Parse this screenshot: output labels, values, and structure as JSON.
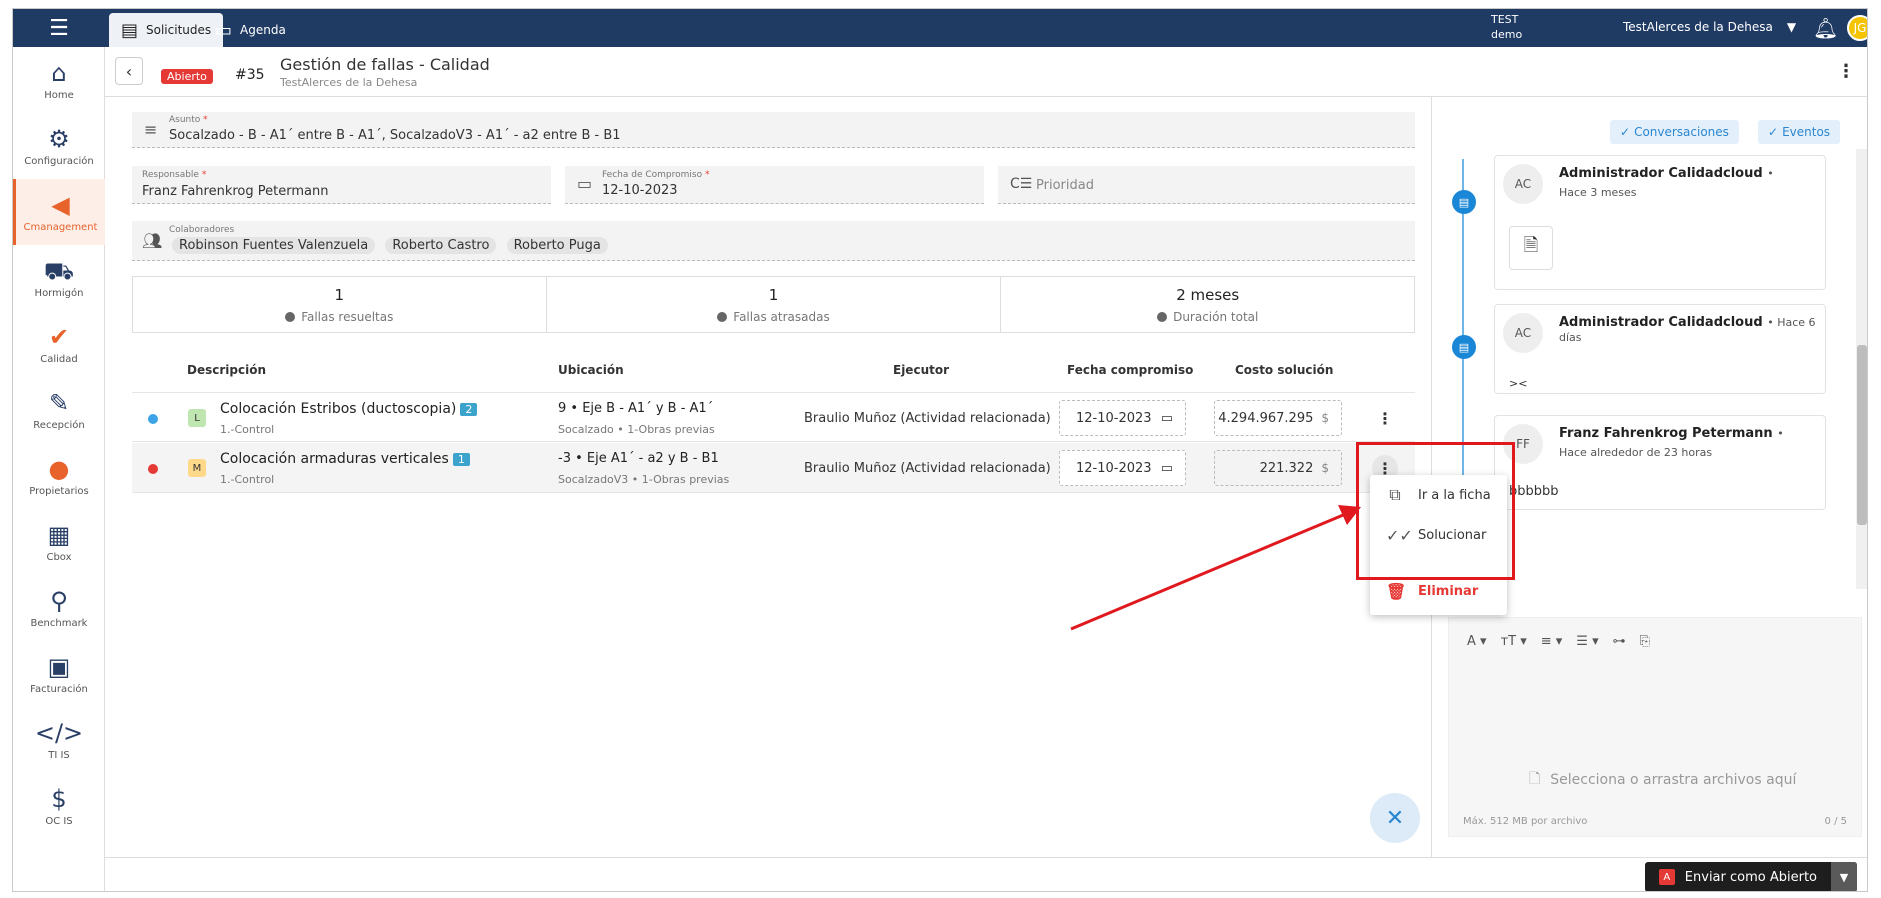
{
  "topbar": {
    "tabs": [
      {
        "label": "Solicitudes",
        "icon": "list-icon"
      },
      {
        "label": "Agenda",
        "icon": "calendar-icon"
      }
    ],
    "env_line1": "TEST",
    "env_line2": "demo",
    "company": "TestAlerces de la Dehesa",
    "avatar_initials": "JG"
  },
  "sidebar": {
    "items": [
      {
        "label": "Home",
        "icon": "home-icon"
      },
      {
        "label": "Configuración",
        "icon": "gear-icon"
      },
      {
        "label": "Cmanagement",
        "icon": "cmanagement-icon",
        "active": true
      },
      {
        "label": "Hormigón",
        "icon": "wheelbarrow-icon"
      },
      {
        "label": "Calidad",
        "icon": "quality-icon"
      },
      {
        "label": "Recepción",
        "icon": "reception-icon"
      },
      {
        "label": "Propietarios",
        "icon": "owner-icon"
      },
      {
        "label": "Cbox",
        "icon": "cbox-icon"
      },
      {
        "label": "Benchmark",
        "icon": "benchmark-icon"
      },
      {
        "label": "Facturación",
        "icon": "invoice-icon"
      },
      {
        "label": "TI IS",
        "icon": "code-icon"
      },
      {
        "label": "OC IS",
        "icon": "dollar-icon"
      }
    ]
  },
  "header": {
    "status": "Abierto",
    "number": "#35",
    "title": "Gestión de fallas - Calidad",
    "subtitle": "TestAlerces de la Dehesa"
  },
  "form": {
    "asunto_label": "Asunto",
    "asunto_value": "Socalzado - B - A1´ entre B - A1´, SocalzadoV3 - A1´ - a2 entre B - B1",
    "responsable_label": "Responsable",
    "responsable_value": "Franz Fahrenkrog Petermann",
    "fecha_label": "Fecha de Compromiso",
    "fecha_value": "12-10-2023",
    "prioridad_placeholder": "Prioridad",
    "colaboradores_label": "Colaboradores",
    "colaboradores": [
      "Robinson Fuentes Valenzuela",
      "Roberto Castro",
      "Roberto Puga"
    ]
  },
  "stats": [
    {
      "value": "1",
      "label": "Fallas resueltas"
    },
    {
      "value": "1",
      "label": "Fallas atrasadas"
    },
    {
      "value": "2 meses",
      "label": "Duración total"
    }
  ],
  "table": {
    "headers": {
      "descripcion": "Descripción",
      "ubicacion": "Ubicación",
      "ejecutor": "Ejecutor",
      "fecha": "Fecha compromiso",
      "costo": "Costo solución"
    },
    "rows": [
      {
        "dot_color": "#3ba3e6",
        "category": "L",
        "category_color": "#bfe6b0",
        "description": "Colocación Estribos (ductoscopia)",
        "count": "2",
        "desc_sub": "1.-Control",
        "location": "9 • Eje B - A1´ y B - A1´",
        "loc_sub": "Socalzado • 1-Obras previas",
        "executor": "Braulio Muñoz (Actividad relacionada)",
        "date": "12-10-2023",
        "cost": "4.294.967.295",
        "currency": "$"
      },
      {
        "dot_color": "#e53935",
        "category": "M",
        "category_color": "#ffd98a",
        "description": "Colocación armaduras verticales",
        "count": "1",
        "desc_sub": "1.-Control",
        "location": "-3 • Eje A1´ - a2 y B - B1",
        "loc_sub": "SocalzadoV3 • 1-Obras previas",
        "executor": "Braulio Muñoz (Actividad relacionada)",
        "date": "12-10-2023",
        "cost": "221.322",
        "currency": "$"
      }
    ]
  },
  "menu": {
    "items": [
      {
        "label": "Ir a la ficha",
        "icon": "external-link-icon"
      },
      {
        "label": "Solucionar",
        "icon": "double-check-icon"
      },
      {
        "label": "Eliminar",
        "icon": "trash-icon"
      }
    ]
  },
  "right_panel": {
    "btn_conversaciones": "Conversaciones",
    "btn_eventos": "Eventos",
    "cards": [
      {
        "initials": "AC",
        "name": "Administrador Calidadcloud",
        "time": "Hace 3 meses",
        "body": ""
      },
      {
        "initials": "AC",
        "name": "Administrador Calidadcloud",
        "time": "Hace 6 días",
        "body": "><"
      },
      {
        "initials": "FF",
        "name": "Franz Fahrenkrog Petermann",
        "time": "Hace alrededor de 23 horas",
        "body": "bbbbbb"
      }
    ],
    "drop_text": "Selecciona o arrastra archivos aquí",
    "max_size": "Máx. 512 MB por archivo",
    "counter": "0 / 5"
  },
  "bottom": {
    "send_label": "Enviar como Abierto",
    "send_badge": "A"
  }
}
